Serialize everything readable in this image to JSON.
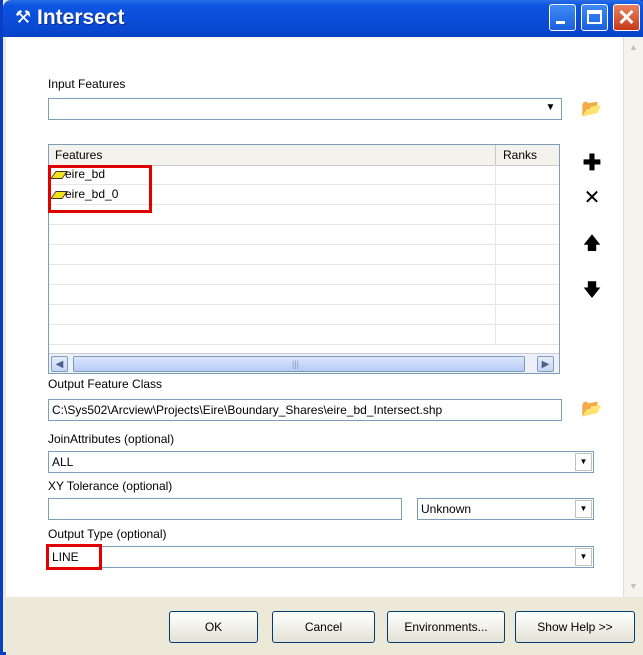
{
  "window": {
    "title": "Intersect",
    "title_icon": "hammer-icon"
  },
  "input_features": {
    "label": "Input Features",
    "value": ""
  },
  "features_grid": {
    "headers": {
      "features": "Features",
      "ranks": "Ranks"
    },
    "rows": [
      {
        "name": "eire_bd",
        "rank": ""
      },
      {
        "name": "eire_bd_0",
        "rank": ""
      }
    ]
  },
  "output_feature_class": {
    "label": "Output Feature Class",
    "value": "C:\\Sys502\\Arcview\\Projects\\Eire\\Boundary_Shares\\eire_bd_Intersect.shp"
  },
  "join_attributes": {
    "label": "JoinAttributes (optional)",
    "value": "ALL"
  },
  "xy_tolerance": {
    "label": "XY Tolerance (optional)",
    "value": "",
    "unit": "Unknown"
  },
  "output_type": {
    "label": "Output Type (optional)",
    "value": "LINE"
  },
  "buttons": {
    "ok": "OK",
    "cancel": "Cancel",
    "environments": "Environments...",
    "show_help": "Show Help >>"
  },
  "colors": {
    "title_bar": "#0a4bd6",
    "highlight_box": "#e00000",
    "dialog_bg": "#ece9d8"
  }
}
